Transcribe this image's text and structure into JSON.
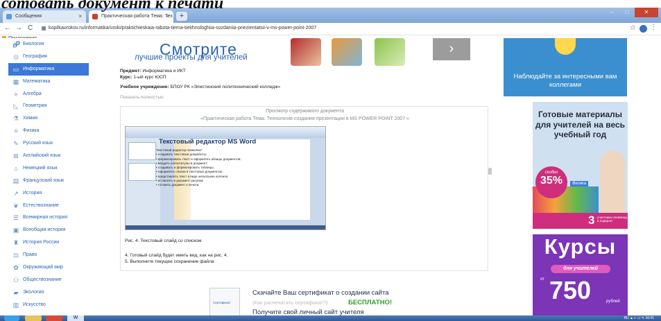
{
  "overlay": {
    "text": "сотовать документ к печати"
  },
  "browser": {
    "tabs": [
      {
        "label": "Сообщения",
        "close": "×"
      },
      {
        "label": "Практическая работа Тема: Тех",
        "close": "×"
      }
    ],
    "new_tab": "+",
    "url": "kopilkaurokov.ru/informatika/uroki/praktichieskaia-rabota-tiema-tiekhnologhiia-sozdaniia-priezientatsii-v-ms-power-point-2007",
    "bookmarks_apps": "Приложения",
    "nav_back": "←",
    "nav_forward": "→",
    "nav_reload": "C"
  },
  "sidebar": {
    "items": [
      {
        "label": "Биология",
        "icon": "🧬"
      },
      {
        "label": "География",
        "icon": "◎"
      },
      {
        "label": "Информатика",
        "icon": "▭"
      },
      {
        "label": "Математика",
        "icon": "▦"
      },
      {
        "label": "Алгебра",
        "icon": "⟡"
      },
      {
        "label": "Геометрия",
        "icon": "◺"
      },
      {
        "label": "Химия",
        "icon": "⚗"
      },
      {
        "label": "Физика",
        "icon": "⚛"
      },
      {
        "label": "Русский язык",
        "icon": "✎"
      },
      {
        "label": "Английский язык",
        "icon": "⊞"
      },
      {
        "label": "Немецкий язык",
        "icon": "⌂"
      },
      {
        "label": "Французский язык",
        "icon": "▤"
      },
      {
        "label": "История",
        "icon": "↗"
      },
      {
        "label": "Естествознание",
        "icon": "❦"
      },
      {
        "label": "Всемирная история",
        "icon": "☰"
      },
      {
        "label": "Всеобщая история",
        "icon": "▣"
      },
      {
        "label": "История России",
        "icon": "♜"
      },
      {
        "label": "Право",
        "icon": "⚖"
      },
      {
        "label": "Окружающий мир",
        "icon": "✿"
      },
      {
        "label": "Обществознание",
        "icon": "⚇"
      },
      {
        "label": "Экология",
        "icon": "▰"
      },
      {
        "label": "Искусство",
        "icon": "▥"
      }
    ],
    "active_index": 2
  },
  "banner": {
    "title": "Смотрите",
    "subtitle": "лучшие проекты для учителей",
    "next": "›"
  },
  "meta": {
    "subject_label": "Предмет:",
    "subject_value": "Информатика и ИКТ",
    "course_label": "Курс:",
    "course_value": "1-ый курс ЮСП",
    "institution_label": "Учебное учреждение:",
    "institution_value": "БПОУ РК «Элистинский политехнический колледж»",
    "show_full": "Показать полностью"
  },
  "viewer": {
    "heading": "Просмотр содержимого документа",
    "doc_title": "«Практическая работа Тема: Технология создания презентации в MS POWER POINT 2007 »",
    "slide_title": "Текстовый редактор MS Word",
    "slide_intro": "Текстовый редактор позволяет:",
    "slide_items": [
      "создавать текстовые документы;",
      "форматировать текст и оформлять абзацы документов;",
      "вводить колонтитулы в документ;",
      "создавать и форматировать таблицы;",
      "оформлять списки в текстовых документах;",
      "представлять текст в виде нескольких колонок;",
      "вставлять в документ рисунки;",
      "готовить документ к печати."
    ],
    "caption": "Рис. 4. Текстовый слайд со списком",
    "step4": "4. Готовый слайд будет иметь вид, как на рис. 4.",
    "step5": "5. Выполните текущее сохранение файла"
  },
  "certificate": {
    "card_label": "Сертификат",
    "line1": "Скачайте Ваш сертификат о создании сайта",
    "line2": "(Как распечатать сертификат?)",
    "free": "БЕСПЛАТНО!",
    "line3": "Получите свой личный сайт учителя"
  },
  "ads": {
    "ad1_text": "Наблюдайте за интересными вам коллегами",
    "ad2_title": "Готовые материалы для учителей на весь учебный год",
    "ad2_disc_small": "скидки",
    "ad2_disc_big": "35%",
    "ad2_physics": "Физика",
    "ad2_num": "3",
    "ad2_strip": "участника олимпиад в подарок!",
    "ad3_title": "Курсы",
    "ad3_pill": "для учителей",
    "ad3_from": "от",
    "ad3_price": "750",
    "ad3_rub": "рублей"
  },
  "taskbar": {
    "word": "W",
    "tray": "RU ▲ ◐ ▭ ✎ 16:01"
  },
  "colors": {
    "link": "#2b63b0",
    "active": "#3b78d8",
    "free": "#2aa12b",
    "ad_blue": "#3b8fcf",
    "ad_purple": "#7b35b6",
    "magenta": "#cf2d7e"
  }
}
